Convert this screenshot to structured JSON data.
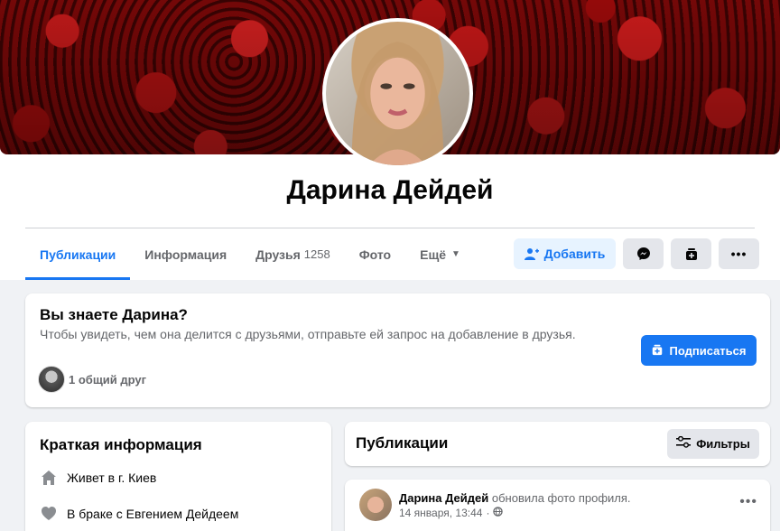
{
  "profile": {
    "name": "Дарина Дейдей"
  },
  "tabs": [
    {
      "label": "Публикации",
      "count": ""
    },
    {
      "label": "Информация",
      "count": ""
    },
    {
      "label": "Друзья",
      "count": "1258"
    },
    {
      "label": "Фото",
      "count": ""
    },
    {
      "label": "Ещё",
      "count": ""
    }
  ],
  "actions": {
    "add_label": "Добавить"
  },
  "know_card": {
    "title": "Вы знаете Дарина?",
    "text": "Чтобы увидеть, чем она делится с друзьями, отправьте ей запрос на добавление в друзья.",
    "mutual": "1 общий друг",
    "subscribe_label": "Подписаться"
  },
  "brief": {
    "title": "Краткая информация",
    "lives_prefix": "Живет в г.",
    "lives_city": "Киев",
    "married_prefix": "В браке с",
    "married_to": "Евгением Дейдеем"
  },
  "posts": {
    "title": "Публикации",
    "filters_label": "Фильтры",
    "item": {
      "author": "Дарина Дейдей",
      "action": "обновила фото профиля.",
      "date": "14 января, 13:44",
      "separator": "·"
    }
  },
  "colors": {
    "accent": "#1877f2",
    "background": "#f0f2f5"
  }
}
